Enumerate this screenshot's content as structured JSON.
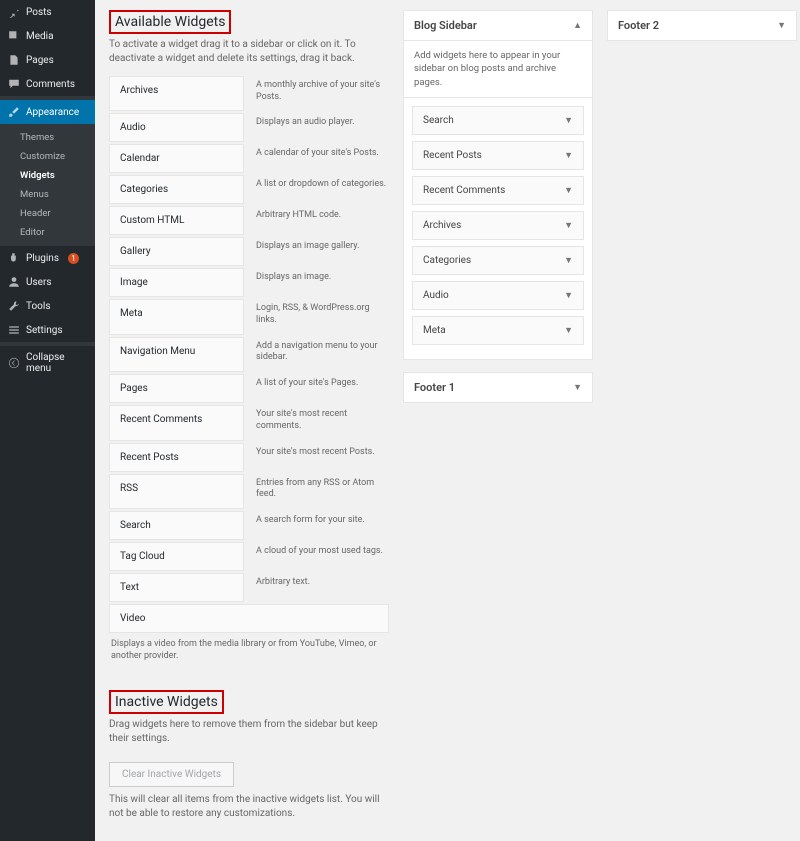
{
  "nav": {
    "posts": "Posts",
    "media": "Media",
    "pages": "Pages",
    "comments": "Comments",
    "appearance": "Appearance",
    "plugins": "Plugins",
    "plugins_badge": "1",
    "users": "Users",
    "tools": "Tools",
    "settings": "Settings",
    "collapse": "Collapse menu",
    "submenu": {
      "themes": "Themes",
      "customize": "Customize",
      "widgets": "Widgets",
      "menus": "Menus",
      "header": "Header",
      "editor": "Editor"
    }
  },
  "available": {
    "title": "Available Widgets",
    "desc": "To activate a widget drag it to a sidebar or click on it. To deactivate a widget and delete its settings, drag it back.",
    "items": [
      {
        "name": "Archives",
        "desc": "A monthly archive of your site's Posts."
      },
      {
        "name": "Audio",
        "desc": "Displays an audio player."
      },
      {
        "name": "Calendar",
        "desc": "A calendar of your site's Posts."
      },
      {
        "name": "Categories",
        "desc": "A list or dropdown of categories."
      },
      {
        "name": "Custom HTML",
        "desc": "Arbitrary HTML code."
      },
      {
        "name": "Gallery",
        "desc": "Displays an image gallery."
      },
      {
        "name": "Image",
        "desc": "Displays an image."
      },
      {
        "name": "Meta",
        "desc": "Login, RSS, & WordPress.org links."
      },
      {
        "name": "Navigation Menu",
        "desc": "Add a navigation menu to your sidebar."
      },
      {
        "name": "Pages",
        "desc": "A list of your site's Pages."
      },
      {
        "name": "Recent Comments",
        "desc": "Your site's most recent comments."
      },
      {
        "name": "Recent Posts",
        "desc": "Your site's most recent Posts."
      },
      {
        "name": "RSS",
        "desc": "Entries from any RSS or Atom feed."
      },
      {
        "name": "Search",
        "desc": "A search form for your site."
      },
      {
        "name": "Tag Cloud",
        "desc": "A cloud of your most used tags."
      },
      {
        "name": "Text",
        "desc": "Arbitrary text."
      },
      {
        "name": "Video",
        "desc": "Displays a video from the media library or from YouTube, Vimeo, or another provider."
      }
    ]
  },
  "inactive": {
    "title": "Inactive Widgets",
    "desc": "Drag widgets here to remove them from the sidebar but keep their settings.",
    "button": "Clear Inactive Widgets",
    "note": "This will clear all items from the inactive widgets list. You will not be able to restore any customizations."
  },
  "areas": {
    "blog": {
      "title": "Blog Sidebar",
      "desc": "Add widgets here to appear in your sidebar on blog posts and archive pages.",
      "widgets": [
        "Search",
        "Recent Posts",
        "Recent Comments",
        "Archives",
        "Categories",
        "Audio",
        "Meta"
      ]
    },
    "footer1": {
      "title": "Footer 1"
    },
    "footer2": {
      "title": "Footer 2"
    }
  }
}
